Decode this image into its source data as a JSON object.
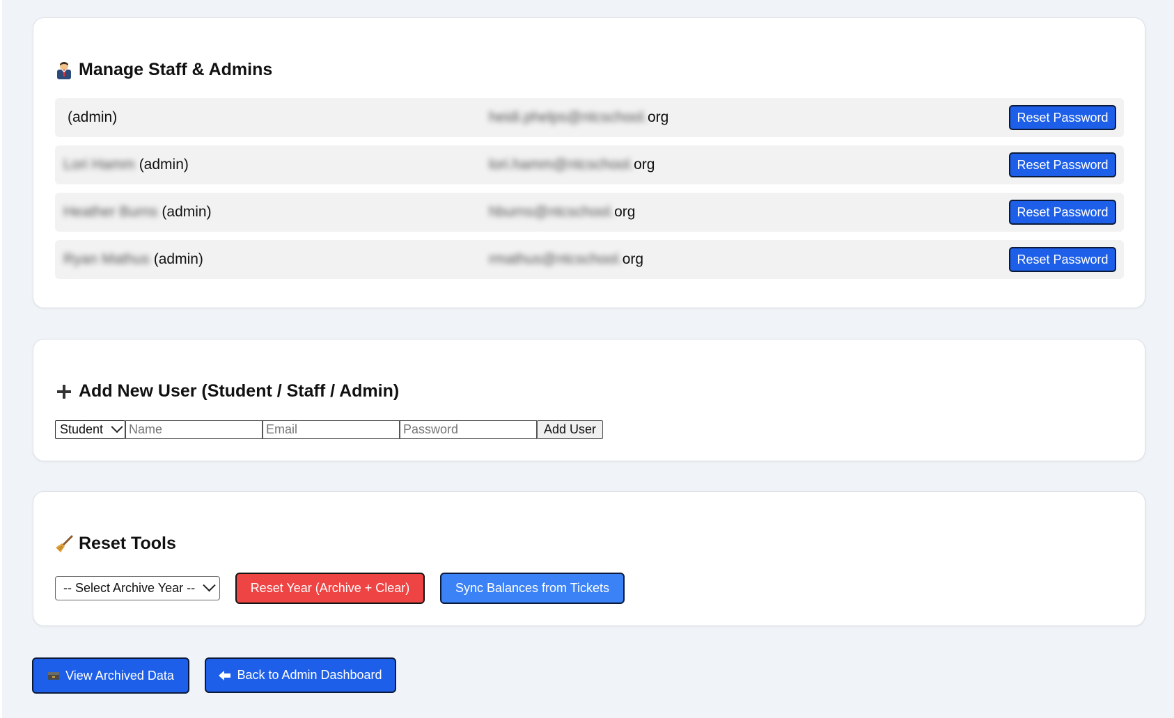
{
  "staff_section": {
    "title": "Manage Staff & Admins",
    "icon": "office-worker-icon",
    "members": [
      {
        "name": "",
        "role": "(admin)",
        "email_blurred": "heidi.phelps@",
        "email_visible": "org",
        "email_mid_blurred": "ntcschool.",
        "action": "Reset Password"
      },
      {
        "name": "Lori Hamm",
        "role": "(admin)",
        "email_blurred": "lori.hamm@",
        "email_visible": "org",
        "email_mid_blurred": "ntcschool.",
        "action": "Reset Password"
      },
      {
        "name": "Heather Burns",
        "role": "(admin)",
        "email_blurred": "hburns@",
        "email_visible": "org",
        "email_mid_blurred": "ntcschool.",
        "action": "Reset Password"
      },
      {
        "name": "Ryan Mathus",
        "role": "(admin)",
        "email_blurred": "rmathus@",
        "email_visible": "org",
        "email_mid_blurred": "ntcschool.",
        "action": "Reset Password"
      }
    ]
  },
  "add_user_section": {
    "title": "Add New User (Student / Staff / Admin)",
    "icon": "plus-icon",
    "role_selected": "Student",
    "name_placeholder": "Name",
    "email_placeholder": "Email",
    "password_placeholder": "Password",
    "submit_label": "Add User"
  },
  "reset_section": {
    "title": "Reset Tools",
    "icon": "broom-icon",
    "year_select_label": "-- Select Archive Year --",
    "reset_year_label": "Reset Year (Archive + Clear)",
    "sync_label": "Sync Balances from Tickets",
    "colors": {
      "reset_year": "#ef4444",
      "sync": "#3b82f6"
    }
  },
  "footer": {
    "archived_label": "View Archived Data",
    "archived_icon": "card-file-box-icon",
    "back_label": "Back to Admin Dashboard",
    "back_icon": "left-arrow-icon"
  }
}
